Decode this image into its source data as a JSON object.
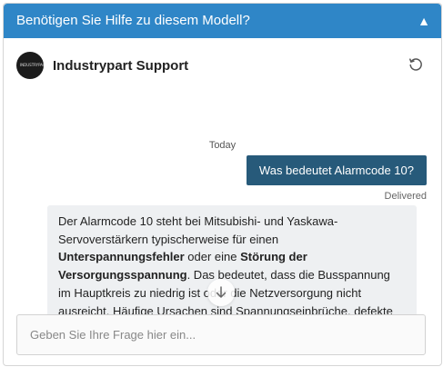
{
  "topbar": {
    "title": "Benötigen Sie Hilfe zu diesem Modell?",
    "toggle_glyph": "▲"
  },
  "header": {
    "agent_name": "Industrypart Support",
    "avatar_text": "INDUSTRYPART",
    "refresh_icon": "refresh-icon"
  },
  "messages": {
    "date_label": "Today",
    "user_message": "Was bedeutet Alarmcode 10?",
    "status": "Delivered",
    "bot_parts": [
      "Der Alarmcode 10 steht bei Mitsubishi- und Yaskawa-Servoverstärkern typischerweise für einen ",
      "Unterspannungsfehler",
      " oder eine ",
      "Störung der Versorgungsspannung",
      ". Das bedeutet, dass die Busspannung im Hauptkreis zu niedrig ist oder die Netzversorgung nicht ausreicht. Häufige Ursachen sind Spannungseinbrüche, defekte Sicherungen oder Probleme mit der Einspeisung."
    ]
  },
  "composer": {
    "placeholder": "Geben Sie Ihre Frage hier ein...",
    "value": ""
  },
  "colors": {
    "topbar": "#2f86c7",
    "user_bubble": "#275a7a",
    "bot_bubble": "#eef0f2"
  }
}
